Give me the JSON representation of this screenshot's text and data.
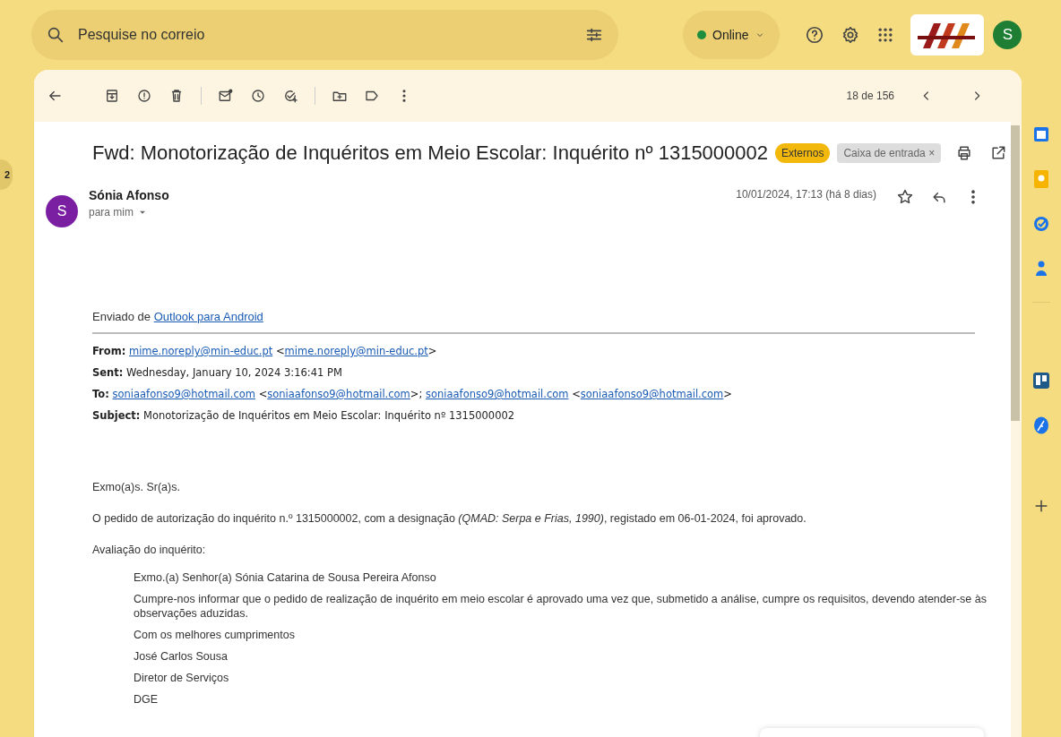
{
  "search": {
    "placeholder": "Pesquise no correio"
  },
  "status": {
    "label": "Online",
    "color": "#1e8e3e"
  },
  "account": {
    "initial": "S"
  },
  "left_badge": "2",
  "pagination": "18 de 156",
  "message": {
    "subject": "Fwd: Monotorização de Inquéritos em Meio Escolar: Inquérito nº 1315000002",
    "labels": [
      {
        "text": "Externos",
        "kind": "user"
      },
      {
        "text": "Caixa de entrada",
        "kind": "system",
        "remove": "×"
      }
    ],
    "sender": {
      "initial": "S",
      "name": "Sónia Afonso",
      "recipient": "para mim"
    },
    "date": "10/01/2024, 17:13 (há 8 dias)",
    "starred": false,
    "sent_from": [
      {
        "kind": "text",
        "text": "Enviado de "
      },
      {
        "kind": "link",
        "text": "Outlook para Android"
      }
    ],
    "headers": [
      {
        "label": "From:",
        "parts": [
          {
            "kind": "link",
            "text": "mime.noreply@min-educ.pt"
          },
          {
            "kind": "text",
            "text": " <"
          },
          {
            "kind": "link",
            "text": "mime.noreply@min-educ.pt"
          },
          {
            "kind": "text",
            "text": ">"
          }
        ]
      },
      {
        "label": "Sent:",
        "parts": [
          {
            "kind": "text",
            "text": "Wednesday, January 10, 2024 3:16:41 PM"
          }
        ]
      },
      {
        "label": "To:",
        "parts": [
          {
            "kind": "link",
            "text": "soniaafonso9@hotmail.com"
          },
          {
            "kind": "text",
            "text": " <"
          },
          {
            "kind": "link",
            "text": "soniaafonso9@hotmail.com"
          },
          {
            "kind": "text",
            "text": ">; "
          },
          {
            "kind": "link",
            "text": "soniaafonso9@hotmail.com"
          },
          {
            "kind": "text",
            "text": " <"
          },
          {
            "kind": "link",
            "text": "soniaafonso9@hotmail.com"
          },
          {
            "kind": "text",
            "text": ">"
          }
        ]
      },
      {
        "label": "Subject:",
        "parts": [
          {
            "kind": "text",
            "text": "Monotorização de Inquéritos em Meio Escolar: Inquérito nº 1315000002"
          }
        ]
      }
    ],
    "body": [
      "Exmo(a)s. Sr(a)s.",
      "O pedido de autorização do inquérito n.º 1315000002, com a designação *(QMAD: Serpa e Frias, 1990)*, registado em 06-01-2024, foi aprovado.",
      "Avaliação do inquérito:"
    ],
    "quote": [
      "Exmo.(a) Senhor(a) Sónia Catarina de Sousa Pereira Afonso",
      "Cumpre-nos informar que o pedido de realização de inquérito em meio escolar é aprovado uma vez que, submetido a análise, cumpre os requisitos, devendo atender-se às observações aduzidas.",
      "Com os melhores cumprimentos",
      "José Carlos Sousa",
      "Diretor de Serviços",
      "DGE"
    ]
  }
}
